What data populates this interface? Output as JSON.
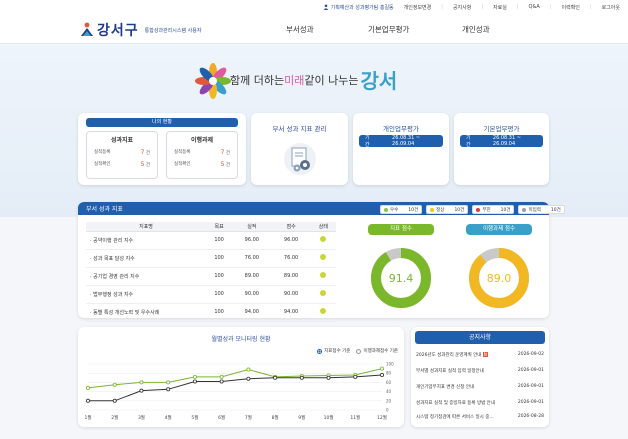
{
  "topbar": {
    "user": "기획예산과 성과평가팀 홍길동",
    "links": [
      "개인정보변경",
      "공지사항",
      "자료실",
      "Q&A",
      "이력확인",
      "로그아웃"
    ]
  },
  "header": {
    "logo_text": "강서구",
    "logo_sub": "통합성과관리시스템 사용자",
    "nav": [
      "부서성과",
      "기본업무평가",
      "개인성과"
    ]
  },
  "hero": {
    "title_prefix": "함께 더하는 ",
    "title_em1": "미래",
    "title_mid": " 같이 나누는 ",
    "title_em2": "강서"
  },
  "my_status": {
    "title": "나의 현황",
    "kpi": {
      "title": "성과지표",
      "rows": [
        {
          "label": "실적등록",
          "value": "7",
          "unit": "건"
        },
        {
          "label": "실적확인",
          "value": "5",
          "unit": "건"
        }
      ]
    },
    "tasks": {
      "title": "이행과제",
      "rows": [
        {
          "label": "실적등록",
          "value": "7",
          "unit": "건"
        },
        {
          "label": "실적확인",
          "value": "5",
          "unit": "건"
        }
      ]
    }
  },
  "dept_card": {
    "title": "부서 성과 지표 관리"
  },
  "personal_card": {
    "title": "개인업무평가",
    "period_label": "기간",
    "period": "26.08.31 ~ 26.09.04"
  },
  "basic_card": {
    "title": "기본업무평가",
    "period_label": "기간",
    "period": "26.08.31 ~ 26.09.04"
  },
  "kpi_panel": {
    "title": "부서 성과 지표",
    "legend": [
      {
        "label": "우수",
        "count": "10건",
        "color": "#8bc34a"
      },
      {
        "label": "정상",
        "count": "10건",
        "color": "#f5c518"
      },
      {
        "label": "부진",
        "count": "10건",
        "color": "#e53935"
      },
      {
        "label": "미입력",
        "count": "10건",
        "color": "#9e9e9e"
      }
    ],
    "columns": [
      "지표명",
      "목표",
      "실적",
      "점수",
      "상태"
    ],
    "rows": [
      {
        "name": "· 공약이행 관리 지수",
        "target": "100",
        "actual": "96.00",
        "score": "96.00"
      },
      {
        "name": "· 성과 목표 달성 지수",
        "target": "100",
        "actual": "76.00",
        "score": "76.00"
      },
      {
        "name": "· 공기업 경영 관리 지수",
        "target": "100",
        "actual": "89.00",
        "score": "89.00"
      },
      {
        "name": "· 법무행정 성과 지수",
        "target": "100",
        "actual": "90.00",
        "score": "90.00"
      },
      {
        "name": "· 동별 특성 개선노력 및 우수사례",
        "target": "100",
        "actual": "94.00",
        "score": "94.00"
      }
    ],
    "donut_kpi": {
      "label": "지표 점수",
      "value": "91.4",
      "fraction": 0.914,
      "color": "#7ab72b",
      "bg": "#c9c9c9"
    },
    "donut_task": {
      "label": "이행과제 점수",
      "value": "89.0",
      "fraction": 0.89,
      "color": "#f2b824",
      "bg": "#c9c9c9"
    }
  },
  "monthly": {
    "title": "월별성과 모니터링 현황",
    "radio1": "지표점수 기준",
    "radio2": "이행과제점수 기준"
  },
  "notice": {
    "title": "공지사항",
    "items": [
      {
        "text": "2026년도 성과관리 운영계획 안내",
        "date": "2026-09-02",
        "new": "N"
      },
      {
        "text": "부서별 성과지표 실적 입력 일정안내",
        "date": "2026-09-01"
      },
      {
        "text": "개인기업무지표 변경 신청 안내",
        "date": "2026-09-01"
      },
      {
        "text": "성과지표 실적 및 증빙자료 등록 방법 안내",
        "date": "2026-09-01"
      },
      {
        "text": "시스템 정기점검에 따른 서비스 일시 중...",
        "date": "2026-08-28"
      }
    ]
  },
  "chart_data": {
    "type": "line",
    "x": [
      "1월",
      "2월",
      "3월",
      "4월",
      "5월",
      "6월",
      "7월",
      "8월",
      "9월",
      "10월",
      "11월",
      "12월"
    ],
    "series": [
      {
        "name": "지표점수 기준",
        "values": [
          48,
          55,
          60,
          60,
          72,
          72,
          88,
          72,
          74,
          75,
          76,
          90
        ],
        "color": "#7ab72b"
      },
      {
        "name": "이행과제점수 기준",
        "values": [
          20,
          20,
          42,
          45,
          62,
          62,
          68,
          70,
          70,
          70,
          72,
          76
        ],
        "color": "#333333"
      }
    ],
    "yticks": [
      "100",
      "80",
      "60",
      "40",
      "20",
      "0"
    ],
    "ylim": [
      0,
      100
    ]
  }
}
